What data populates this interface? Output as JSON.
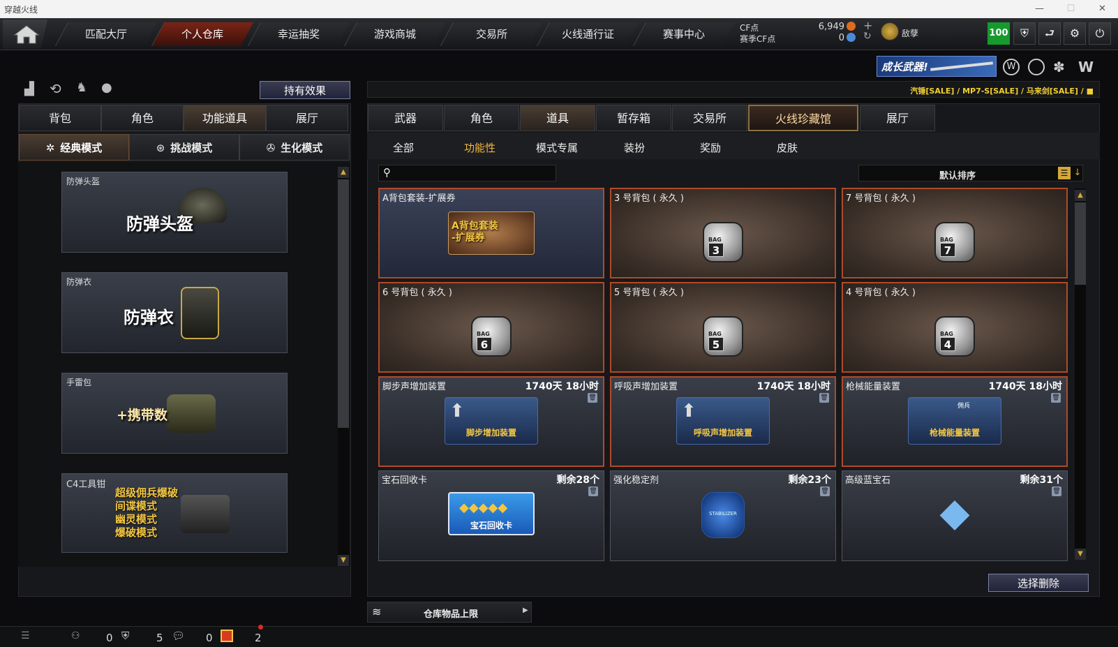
{
  "window": {
    "title": "穿越火线",
    "minimize": "—",
    "maximize": "☐",
    "close": "✕"
  },
  "nav": {
    "tabs": [
      {
        "label": "匹配大厅",
        "active": false
      },
      {
        "label": "个人仓库",
        "active": true
      },
      {
        "label": "幸运抽奖",
        "active": false
      },
      {
        "label": "游戏商城",
        "active": false
      },
      {
        "label": "交易所",
        "active": false
      },
      {
        "label": "火线通行证",
        "active": false
      },
      {
        "label": "赛事中心",
        "active": false
      }
    ]
  },
  "currency": {
    "cf_label": "CF点",
    "cf_value": "6,949",
    "season_label": "赛季CF点",
    "season_value": "0",
    "user_name": "敌孽",
    "level_badge": "100"
  },
  "banner": {
    "growth_weapon": "成长武器!",
    "ticker": "汽锤[SALE] / MP7-S[SALE] / 马来剑[SALE] / ■"
  },
  "left": {
    "effects_button": "持有效果",
    "tabs": [
      {
        "label": "背包",
        "active": false
      },
      {
        "label": "角色",
        "active": false
      },
      {
        "label": "功能道具",
        "active": true
      },
      {
        "label": "展厅",
        "active": false
      }
    ],
    "modes": [
      {
        "label": "经典模式",
        "active": true
      },
      {
        "label": "挑战模式",
        "active": false
      },
      {
        "label": "生化模式",
        "active": false
      }
    ],
    "cards": [
      {
        "caption": "防弹头盔",
        "big": "防弹头盔"
      },
      {
        "caption": "防弹衣",
        "big": "防弹衣"
      },
      {
        "caption": "手雷包",
        "big": "+携带数"
      },
      {
        "caption": "C4工具钳",
        "lines": [
          "超级佣兵爆破",
          "间谍模式",
          "幽灵模式",
          "爆破模式"
        ]
      }
    ]
  },
  "right": {
    "tabs": [
      {
        "label": "武器",
        "active": false
      },
      {
        "label": "角色",
        "active": false
      },
      {
        "label": "道具",
        "active": true
      },
      {
        "label": "暂存箱",
        "active": false
      },
      {
        "label": "交易所",
        "active": false
      },
      {
        "label": "火线珍藏馆",
        "active": false,
        "gold": true
      },
      {
        "label": "展厅",
        "active": false
      }
    ],
    "subtabs": [
      {
        "label": "全部",
        "active": false
      },
      {
        "label": "功能性",
        "active": true
      },
      {
        "label": "模式专属",
        "active": false
      },
      {
        "label": "装扮",
        "active": false
      },
      {
        "label": "奖励",
        "active": false
      },
      {
        "label": "皮肤",
        "active": false
      }
    ],
    "search_placeholder": "",
    "sort_label": "默认排序",
    "items": [
      {
        "name": "A背包套装-扩展券",
        "style": "blue",
        "art_text": "A背包套装\n-扩展券"
      },
      {
        "name": "3 号背包 ( 永久 )",
        "style": "warm",
        "bag_label": "BAG",
        "bag_num": "3"
      },
      {
        "name": "7 号背包 ( 永久 )",
        "style": "warm",
        "bag_label": "BAG",
        "bag_num": "7"
      },
      {
        "name": "6 号背包 ( 永久 )",
        "style": "warm",
        "bag_label": "BAG",
        "bag_num": "6"
      },
      {
        "name": "5 号背包 ( 永久 )",
        "style": "warm",
        "bag_label": "BAG",
        "bag_num": "5"
      },
      {
        "name": "4 号背包 ( 永久 )",
        "style": "warm",
        "bag_label": "BAG",
        "bag_num": "4"
      },
      {
        "name": "脚步声增加装置",
        "style": "orb",
        "right": "1740天 18小时",
        "art_text": "脚步增加装置"
      },
      {
        "name": "呼吸声增加装置",
        "style": "orb",
        "right": "1740天 18小时",
        "art_text": "呼吸声增加装置"
      },
      {
        "name": "枪械能量装置",
        "style": "orb",
        "right": "1740天 18小时",
        "art_text": "枪械能量装置",
        "art_sub": "佣兵"
      },
      {
        "name": "宝石回收卡",
        "style": "dark",
        "right": "剩余28个",
        "art_text": "宝石回收卡"
      },
      {
        "name": "强化稳定剂",
        "style": "dark",
        "right": "剩余23个",
        "art_text": "STABILIZER"
      },
      {
        "name": "高级蓝宝石",
        "style": "dark",
        "right": "剩余31个"
      }
    ],
    "delete_button": "选择删除",
    "storage_limit": "仓库物品上限"
  },
  "bottom": {
    "count1": "0",
    "count2": "5",
    "count3": "0",
    "count4": "2"
  }
}
